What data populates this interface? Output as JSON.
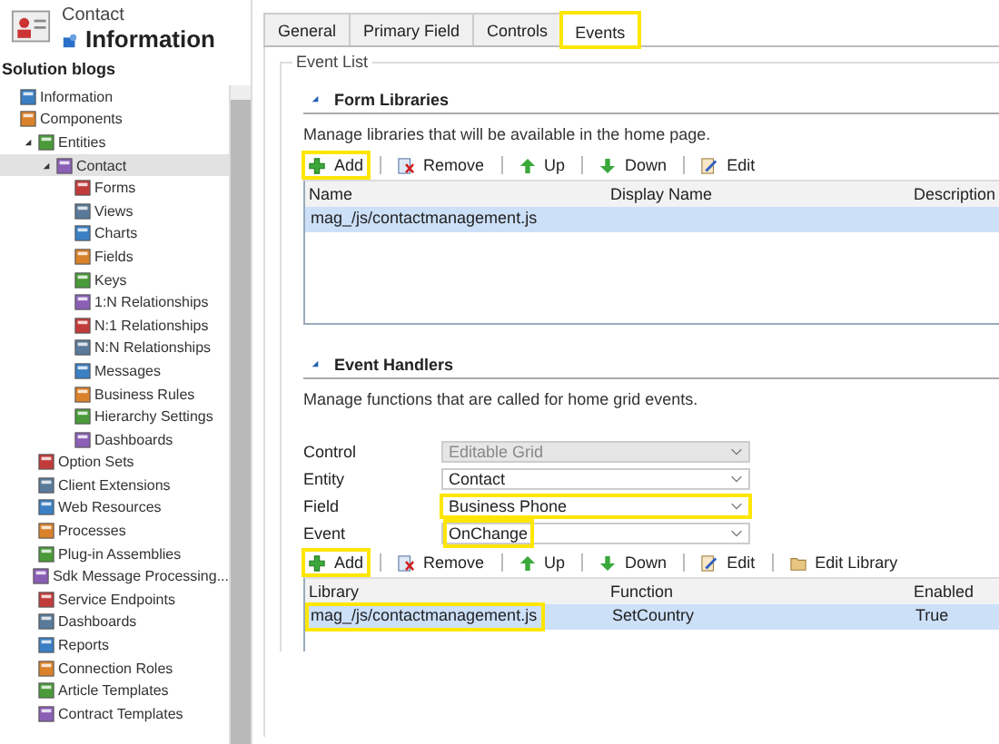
{
  "header": {
    "entity": "Contact",
    "title": "Information"
  },
  "sidebar": {
    "title": "Solution blogs",
    "items": [
      {
        "label": "Information",
        "selected": false
      },
      {
        "label": "Components",
        "selected": false,
        "children": [
          {
            "label": "Entities",
            "selected": false,
            "expanded": true,
            "children": [
              {
                "label": "Contact",
                "selected": true,
                "expanded": true,
                "children": [
                  {
                    "label": "Forms",
                    "selected": false
                  },
                  {
                    "label": "Views",
                    "selected": false
                  },
                  {
                    "label": "Charts",
                    "selected": false
                  },
                  {
                    "label": "Fields",
                    "selected": false
                  },
                  {
                    "label": "Keys",
                    "selected": false
                  },
                  {
                    "label": "1:N Relationships",
                    "selected": false
                  },
                  {
                    "label": "N:1 Relationships",
                    "selected": false
                  },
                  {
                    "label": "N:N Relationships",
                    "selected": false
                  },
                  {
                    "label": "Messages",
                    "selected": false
                  },
                  {
                    "label": "Business Rules",
                    "selected": false
                  },
                  {
                    "label": "Hierarchy Settings",
                    "selected": false
                  },
                  {
                    "label": "Dashboards",
                    "selected": false
                  }
                ]
              }
            ]
          },
          {
            "label": "Option Sets",
            "selected": false
          },
          {
            "label": "Client Extensions",
            "selected": false
          },
          {
            "label": "Web Resources",
            "selected": false
          },
          {
            "label": "Processes",
            "selected": false
          },
          {
            "label": "Plug-in Assemblies",
            "selected": false
          },
          {
            "label": "Sdk Message Processing...",
            "selected": false
          },
          {
            "label": "Service Endpoints",
            "selected": false
          },
          {
            "label": "Dashboards",
            "selected": false
          },
          {
            "label": "Reports",
            "selected": false
          },
          {
            "label": "Connection Roles",
            "selected": false
          },
          {
            "label": "Article Templates",
            "selected": false
          },
          {
            "label": "Contract Templates",
            "selected": false
          }
        ]
      }
    ]
  },
  "tabs": [
    {
      "label": "General",
      "selected": false,
      "highlighted": false
    },
    {
      "label": "Primary Field",
      "selected": false,
      "highlighted": false
    },
    {
      "label": "Controls",
      "selected": false,
      "highlighted": false
    },
    {
      "label": "Events",
      "selected": true,
      "highlighted": true
    }
  ],
  "event_list": {
    "legend": "Event List",
    "form_libraries": {
      "title": "Form Libraries",
      "description": "Manage libraries that will be available in the home page.",
      "toolbar": [
        {
          "kind": "add",
          "label": "Add",
          "highlighted": true
        },
        {
          "kind": "remove",
          "label": "Remove",
          "highlighted": false
        },
        {
          "kind": "up",
          "label": "Up",
          "highlighted": false
        },
        {
          "kind": "down",
          "label": "Down",
          "highlighted": false
        },
        {
          "kind": "edit",
          "label": "Edit",
          "highlighted": false
        }
      ],
      "columns": [
        "Name",
        "Display Name",
        "Description"
      ],
      "rows": [
        {
          "selected": true,
          "cells": [
            {
              "text": "mag_/js/contactmanagement.js"
            }
          ]
        }
      ]
    },
    "event_handlers": {
      "title": "Event Handlers",
      "description": "Manage functions that are called for home grid events.",
      "fields": [
        {
          "label": "Control",
          "value": "Editable Grid",
          "disabled": true
        },
        {
          "label": "Entity",
          "value": "Contact",
          "disabled": false
        },
        {
          "label": "Field",
          "value": "Business Phone",
          "disabled": false,
          "highlighted": true,
          "value_highlighted": false
        },
        {
          "label": "Event",
          "value": "OnChange",
          "disabled": false,
          "highlighted": false,
          "value_highlighted": true
        }
      ],
      "toolbar": [
        {
          "kind": "add",
          "label": "Add",
          "highlighted": true
        },
        {
          "kind": "remove",
          "label": "Remove",
          "highlighted": false
        },
        {
          "kind": "up",
          "label": "Up",
          "highlighted": false
        },
        {
          "kind": "down",
          "label": "Down",
          "highlighted": false
        },
        {
          "kind": "edit",
          "label": "Edit",
          "highlighted": false
        },
        {
          "kind": "library",
          "label": "Edit Library",
          "highlighted": false
        }
      ],
      "columns": [
        "Library",
        "Function",
        "Enabled"
      ],
      "rows": [
        {
          "selected": true,
          "cells": [
            {
              "text": "mag_/js/contactmanagement.js",
              "highlighted": true
            },
            {
              "text": "SetCountry",
              "highlighted": false
            },
            {
              "text": "True",
              "highlighted": false
            }
          ]
        }
      ]
    }
  }
}
